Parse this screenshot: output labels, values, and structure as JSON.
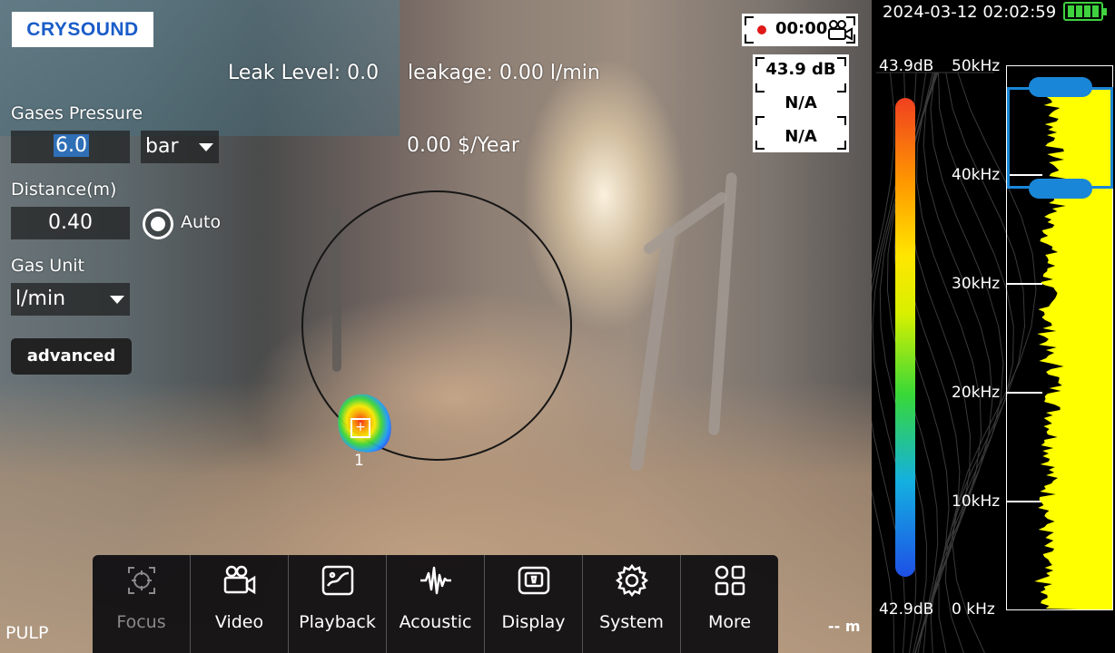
{
  "brand": {
    "logo_text": "CRYSOUND",
    "logo_color": "#1a5cc8"
  },
  "readouts": {
    "leak_level": "Leak Level: 0.0",
    "leakage": "leakage: 0.00 l/min",
    "cost": "0.00 $/Year"
  },
  "controls": {
    "gases_pressure_label": "Gases Pressure",
    "pressure_value": "6.0",
    "pressure_unit": "bar",
    "distance_label": "Distance(m)",
    "distance_value": "0.40",
    "auto_label": "Auto",
    "auto_selected": true,
    "gas_unit_label": "Gas Unit",
    "gas_unit_value": "l/min",
    "advanced_label": "advanced"
  },
  "recording": {
    "time": "00:00",
    "icon": "video-camera-icon",
    "dot_color": "#e01818"
  },
  "db_box": {
    "line1": "43.9 dB",
    "line2": "N/A",
    "line3": "N/A"
  },
  "leak_marker": {
    "index": "1",
    "icon": "crosshair-plus-icon"
  },
  "toolbar": {
    "items": [
      {
        "label": "Focus",
        "icon": "focus-target-icon",
        "disabled": true
      },
      {
        "label": "Video",
        "icon": "video-camera-icon",
        "disabled": false
      },
      {
        "label": "Playback",
        "icon": "playback-image-icon",
        "disabled": false
      },
      {
        "label": "Acoustic",
        "icon": "waveform-icon",
        "disabled": false
      },
      {
        "label": "Display",
        "icon": "display-icon",
        "disabled": false
      },
      {
        "label": "System",
        "icon": "gear-icon",
        "disabled": false
      },
      {
        "label": "More",
        "icon": "grid-more-icon",
        "disabled": false
      }
    ]
  },
  "status": {
    "mode": "PULP",
    "distance_readout": "-- m"
  },
  "right_panel": {
    "datetime": "2024-03-12 02:02:59",
    "battery_color": "#3fd23f",
    "db_max": "43.9dB",
    "db_min": "42.9dB",
    "freq_labels": [
      "50kHz",
      "40kHz",
      "30kHz",
      "20kHz",
      "10kHz",
      "0  kHz"
    ],
    "selection_color": "#1a86d8",
    "spectrum_color": "#ffff00",
    "selection_range_khz": [
      38.5,
      47.8
    ]
  }
}
